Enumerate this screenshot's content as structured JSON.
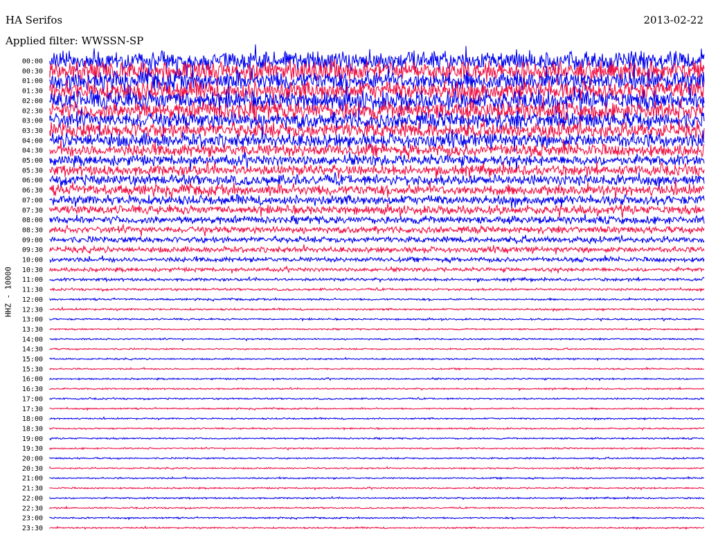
{
  "header": {
    "station": "HA Serifos",
    "date": "2013-02-22",
    "filter": "Applied filter: WWSSN-SP",
    "channel": "HHZ - 10000"
  },
  "chart_data": {
    "type": "line",
    "title": "HA Serifos",
    "subtitle": "Applied filter: WWSSN-SP",
    "ylabel": "HHZ - 10000",
    "xlabel": "",
    "colors": [
      "#0000ee",
      "#ee1144"
    ],
    "grid": false,
    "rows": [
      {
        "time": "00:00",
        "amplitude": 1.0
      },
      {
        "time": "00:30",
        "amplitude": 1.0
      },
      {
        "time": "01:00",
        "amplitude": 1.0
      },
      {
        "time": "01:30",
        "amplitude": 1.0
      },
      {
        "time": "02:00",
        "amplitude": 1.0
      },
      {
        "time": "02:30",
        "amplitude": 0.95
      },
      {
        "time": "03:00",
        "amplitude": 0.85
      },
      {
        "time": "03:30",
        "amplitude": 0.8
      },
      {
        "time": "04:00",
        "amplitude": 0.75
      },
      {
        "time": "04:30",
        "amplitude": 0.65
      },
      {
        "time": "05:00",
        "amplitude": 0.55
      },
      {
        "time": "05:30",
        "amplitude": 0.55
      },
      {
        "time": "06:00",
        "amplitude": 0.55
      },
      {
        "time": "06:30",
        "amplitude": 0.55
      },
      {
        "time": "07:00",
        "amplitude": 0.5
      },
      {
        "time": "07:30",
        "amplitude": 0.45
      },
      {
        "time": "08:00",
        "amplitude": 0.4
      },
      {
        "time": "08:30",
        "amplitude": 0.35
      },
      {
        "time": "09:00",
        "amplitude": 0.32
      },
      {
        "time": "09:30",
        "amplitude": 0.3
      },
      {
        "time": "10:00",
        "amplitude": 0.25
      },
      {
        "time": "10:30",
        "amplitude": 0.2
      },
      {
        "time": "11:00",
        "amplitude": 0.15
      },
      {
        "time": "11:30",
        "amplitude": 0.12
      },
      {
        "time": "12:00",
        "amplitude": 0.1
      },
      {
        "time": "12:30",
        "amplitude": 0.1
      },
      {
        "time": "13:00",
        "amplitude": 0.09
      },
      {
        "time": "13:30",
        "amplitude": 0.08
      },
      {
        "time": "14:00",
        "amplitude": 0.08
      },
      {
        "time": "14:30",
        "amplitude": 0.08
      },
      {
        "time": "15:00",
        "amplitude": 0.08
      },
      {
        "time": "15:30",
        "amplitude": 0.08
      },
      {
        "time": "16:00",
        "amplitude": 0.08
      },
      {
        "time": "16:30",
        "amplitude": 0.08
      },
      {
        "time": "17:00",
        "amplitude": 0.08
      },
      {
        "time": "17:30",
        "amplitude": 0.08
      },
      {
        "time": "18:00",
        "amplitude": 0.08
      },
      {
        "time": "18:30",
        "amplitude": 0.08
      },
      {
        "time": "19:00",
        "amplitude": 0.08
      },
      {
        "time": "19:30",
        "amplitude": 0.08
      },
      {
        "time": "20:00",
        "amplitude": 0.08
      },
      {
        "time": "20:30",
        "amplitude": 0.08
      },
      {
        "time": "21:00",
        "amplitude": 0.08
      },
      {
        "time": "21:30",
        "amplitude": 0.08
      },
      {
        "time": "22:00",
        "amplitude": 0.08
      },
      {
        "time": "22:30",
        "amplitude": 0.08
      },
      {
        "time": "23:00",
        "amplitude": 0.08
      },
      {
        "time": "23:30",
        "amplitude": 0.08
      }
    ]
  }
}
